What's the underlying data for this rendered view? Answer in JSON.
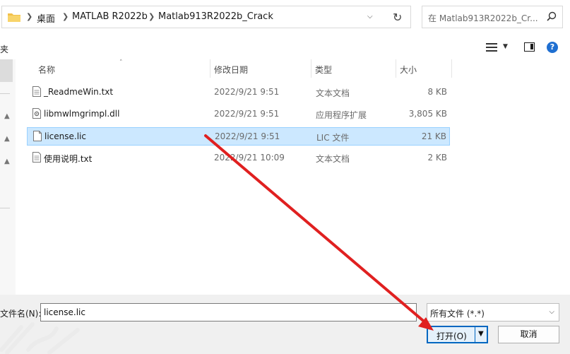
{
  "address": {
    "crumbs": [
      "桌面",
      "MATLAB R2022b",
      "Matlab913R2022b_Crack"
    ]
  },
  "search": {
    "placeholder": "在 Matlab913R2022b_Cr..."
  },
  "toolbar": {
    "partial_label": "夹"
  },
  "columns": {
    "name": "名称",
    "date": "修改日期",
    "type": "类型",
    "size": "大小"
  },
  "files": [
    {
      "name": "_ReadmeWin.txt",
      "date": "2022/9/21 9:51",
      "type": "文本文档",
      "size": "8 KB",
      "icon": "text-file-icon"
    },
    {
      "name": "libmwlmgrimpl.dll",
      "date": "2022/9/21 9:51",
      "type": "应用程序扩展",
      "size": "3,805 KB",
      "icon": "dll-file-icon"
    },
    {
      "name": "license.lic",
      "date": "2022/9/21 9:51",
      "type": "LIC 文件",
      "size": "21 KB",
      "icon": "blank-file-icon",
      "selected": true
    },
    {
      "name": "使用说明.txt",
      "date": "2022/9/21 10:09",
      "type": "文本文档",
      "size": "2 KB",
      "icon": "text-file-icon"
    }
  ],
  "footer": {
    "filename_label": "文件名(N):",
    "filename_value": "license.lic",
    "filetype_value": "所有文件 (*.*)",
    "open_label": "打开(O)",
    "cancel_label": "取消"
  },
  "colors": {
    "accent": "#0067c0",
    "selection": "#cce8ff",
    "annotation": "#e02020"
  }
}
